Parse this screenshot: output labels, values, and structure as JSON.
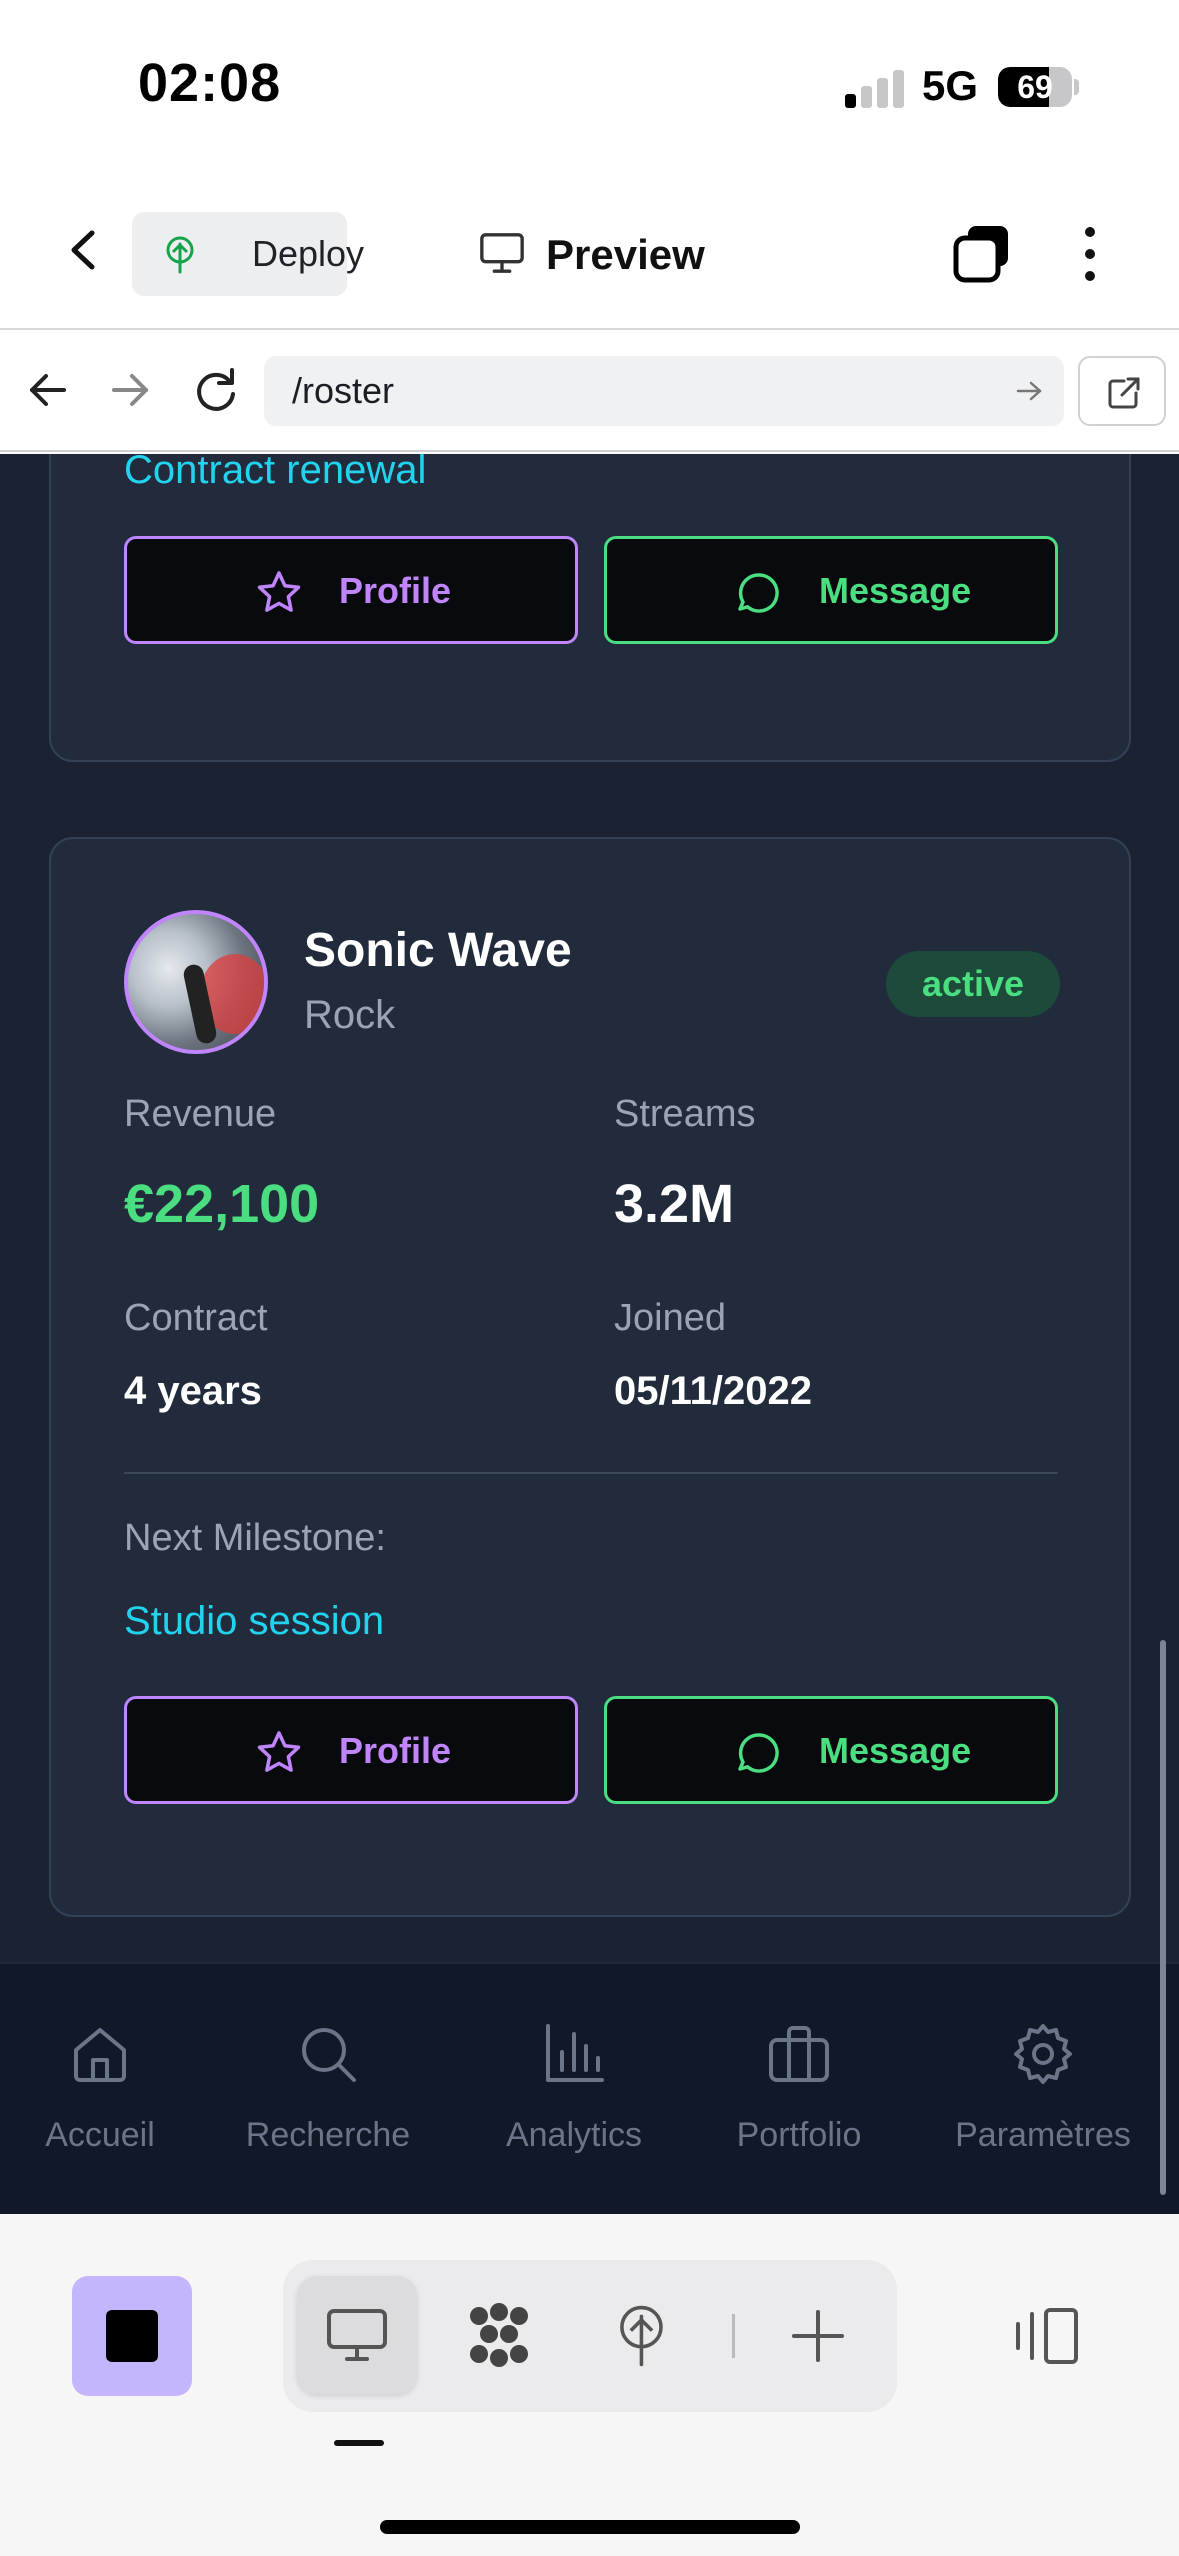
{
  "status_bar": {
    "time": "02:08",
    "network": "5G",
    "battery": "69",
    "battery_level": 0.69,
    "signal_bars_active": 1,
    "signal_bars_total": 4
  },
  "header": {
    "deploy_label": "Deploy",
    "preview_label": "Preview"
  },
  "url_bar": {
    "url": "/roster"
  },
  "cards": [
    {
      "milestone_value": "Contract renewal",
      "profile_label": "Profile",
      "message_label": "Message"
    },
    {
      "name": "Sonic Wave",
      "genre": "Rock",
      "status": "active",
      "revenue_label": "Revenue",
      "revenue_value": "€22,100",
      "streams_label": "Streams",
      "streams_value": "3.2M",
      "contract_label": "Contract",
      "contract_value": "4 years",
      "joined_label": "Joined",
      "joined_value": "05/11/2022",
      "milestone_label": "Next Milestone:",
      "milestone_value": "Studio session",
      "profile_label": "Profile",
      "message_label": "Message"
    }
  ],
  "bottom_nav": {
    "items": [
      {
        "label": "Accueil",
        "icon": "home-icon"
      },
      {
        "label": "Recherche",
        "icon": "search-icon"
      },
      {
        "label": "Analytics",
        "icon": "bar-chart-icon"
      },
      {
        "label": "Portfolio",
        "icon": "briefcase-icon"
      },
      {
        "label": "Paramètres",
        "icon": "gear-icon"
      }
    ]
  },
  "colors": {
    "background": "#1b2333",
    "card": "#212b3c",
    "accent_purple": "#c084fc",
    "accent_green": "#4ade80",
    "accent_cyan": "#22d3ee",
    "stop_button": "#c4b5fd"
  }
}
